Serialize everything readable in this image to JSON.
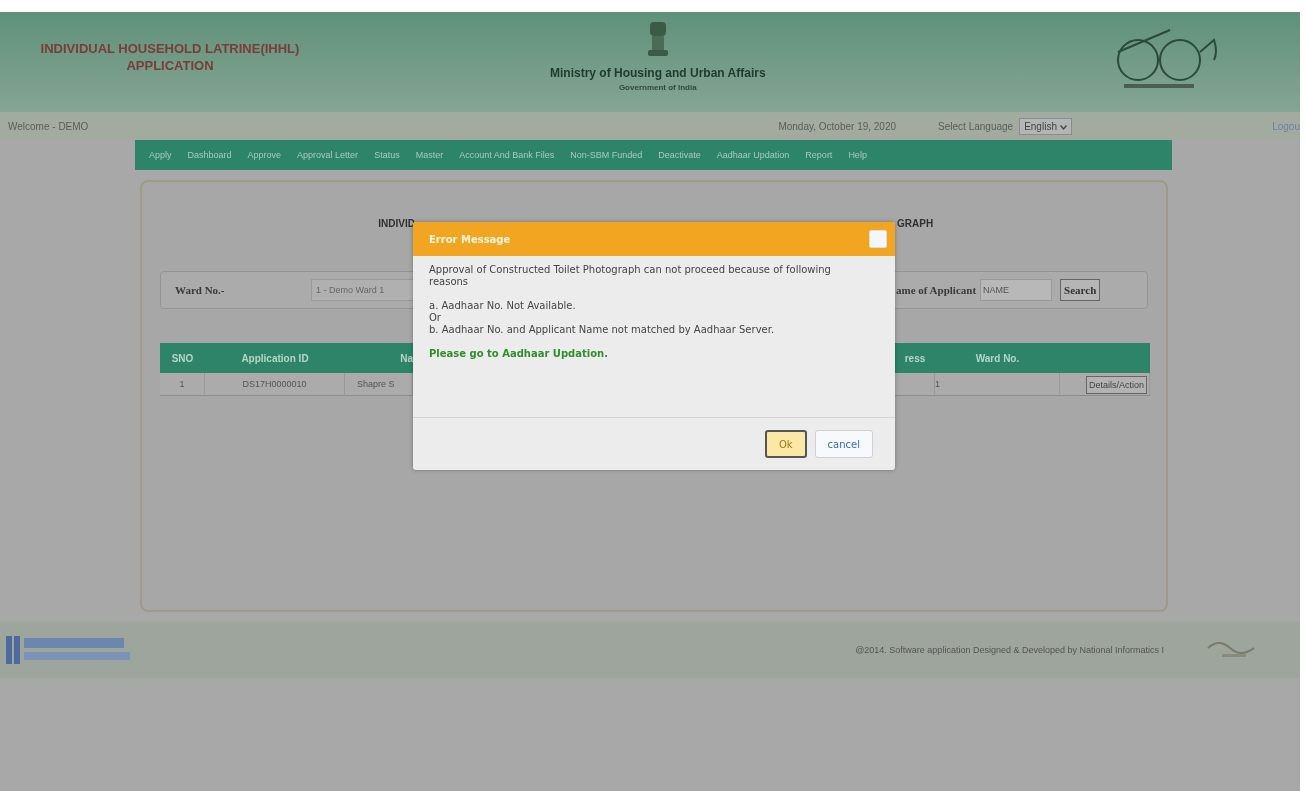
{
  "header": {
    "app_title": "INDIVIDUAL HOUSEHOLD LATRINE(IHHL)\nAPPLICATION",
    "ministry": "Ministry of Housing and Urban Affairs",
    "government": "Government of India"
  },
  "top_bar": {
    "welcome": "Welcome - DEMO",
    "date": "Monday, October 19, 2020",
    "language_label": "Select Language",
    "language": "English",
    "logout": "Logou"
  },
  "nav": [
    "Apply",
    "Dashboard",
    "Approve",
    "Approval Letter",
    "Status",
    "Master",
    "Account And Bank Files",
    "Non-SBM Funded",
    "Deactivate",
    "Aadhaar Updation",
    "Report",
    "Help"
  ],
  "page_title": {
    "left": "INDIVID",
    "right": "GRAPH"
  },
  "filter": {
    "ward_label": "Ward No.-",
    "ward_value": "1 - Demo Ward 1",
    "name_label": "ame of Applicant",
    "name_placeholder": "NAME",
    "search": "Search"
  },
  "table": {
    "columns": [
      "SNO",
      "Application ID",
      "Na",
      "ress",
      "Ward No."
    ],
    "rows": [
      {
        "cells": [
          "1",
          "DS17H0000010",
          "Shapre S",
          "1"
        ],
        "action": "Details/Action"
      }
    ]
  },
  "footer": {
    "credit": "@2014. Software application Designed & Developed by National Informatics I"
  },
  "dialog": {
    "title": "Error Message",
    "paragraphs": [
      [
        "Approval of Constructed Toilet Photograph can not proceed because of following reasons"
      ],
      [
        "a. Aadhaar No. Not Available.",
        "Or",
        "b. Aadhaar No. and Applicant Name not matched by Aadhaar Server."
      ]
    ],
    "hint": "Please go to Aadhaar Updation.",
    "buttons": [
      {
        "label": "Ok",
        "selected": true
      },
      {
        "label": "cancel",
        "selected": false
      }
    ]
  }
}
